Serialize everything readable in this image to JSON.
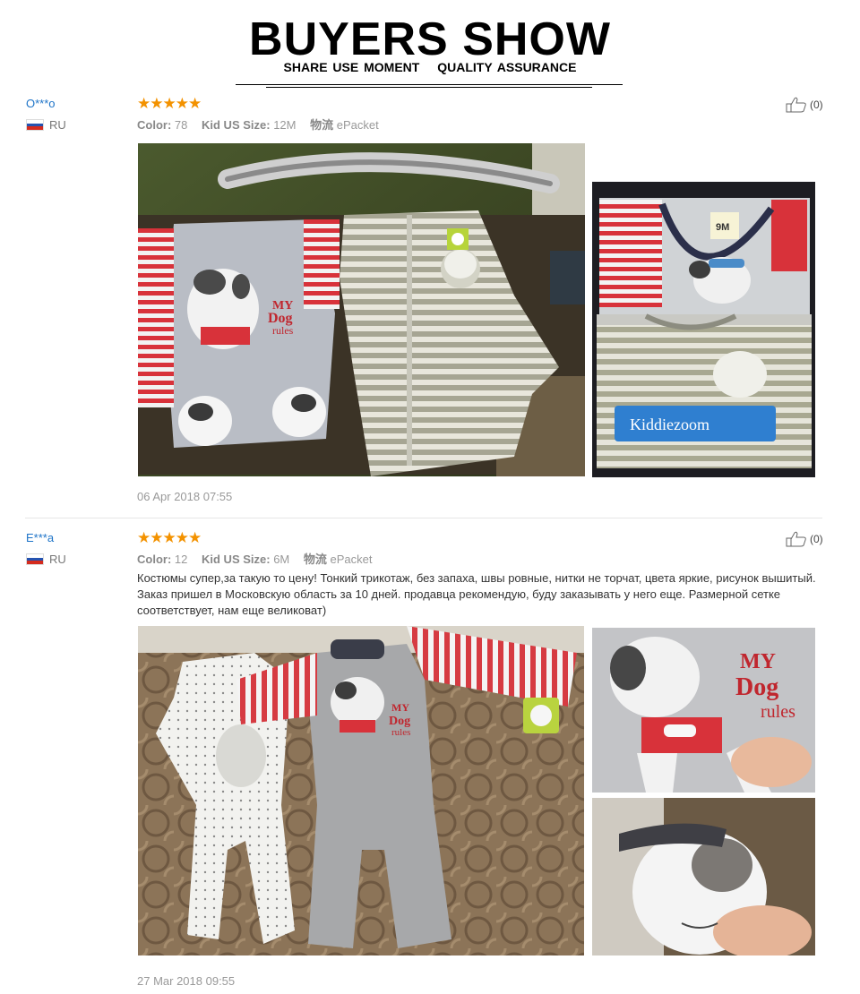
{
  "header": {
    "title": "BUYERS SHOW",
    "subtitle_left": "SHARE USE MOMENT",
    "subtitle_right": "QUALITY ASSURANCE"
  },
  "reviews": [
    {
      "user": "O***o",
      "country": "RU",
      "rating": "★★★★★",
      "color_label": "Color:",
      "color_value": "78",
      "size_label": "Kid US Size:",
      "size_value": "12M",
      "shipping_label": "物流",
      "shipping_value": "ePacket",
      "helpful": "(0)",
      "text": "",
      "date": "06 Apr 2018 07:55"
    },
    {
      "user": "E***a",
      "country": "RU",
      "rating": "★★★★★",
      "color_label": "Color:",
      "color_value": "12",
      "size_label": "Kid US Size:",
      "size_value": "6M",
      "shipping_label": "物流",
      "shipping_value": "ePacket",
      "helpful": "(0)",
      "text": "Костюмы супер,за такую то цену! Тонкий трикотаж, без запаха, швы ровные, нитки не торчат, цвета яркие, рисунок вышитый. Заказ пришел в Московскую область за 10 дней. продавца рекомендую, буду заказывать у него еще. Размерной сетке соответствует, нам еще великоват)",
      "date": "27 Mar 2018 09:55"
    }
  ],
  "photo_text": {
    "dog_small_1": "MY",
    "dog_small_2": "Dog",
    "dog_small_3": "rules",
    "size_tag": "9M",
    "brand_tag": "Kiddiezoom",
    "dog_big_1": "MY",
    "dog_big_2": "Dog",
    "dog_big_3": "rules"
  },
  "colors": {
    "star": "#f39200",
    "username": "#1e74c8",
    "muted": "#999999"
  }
}
